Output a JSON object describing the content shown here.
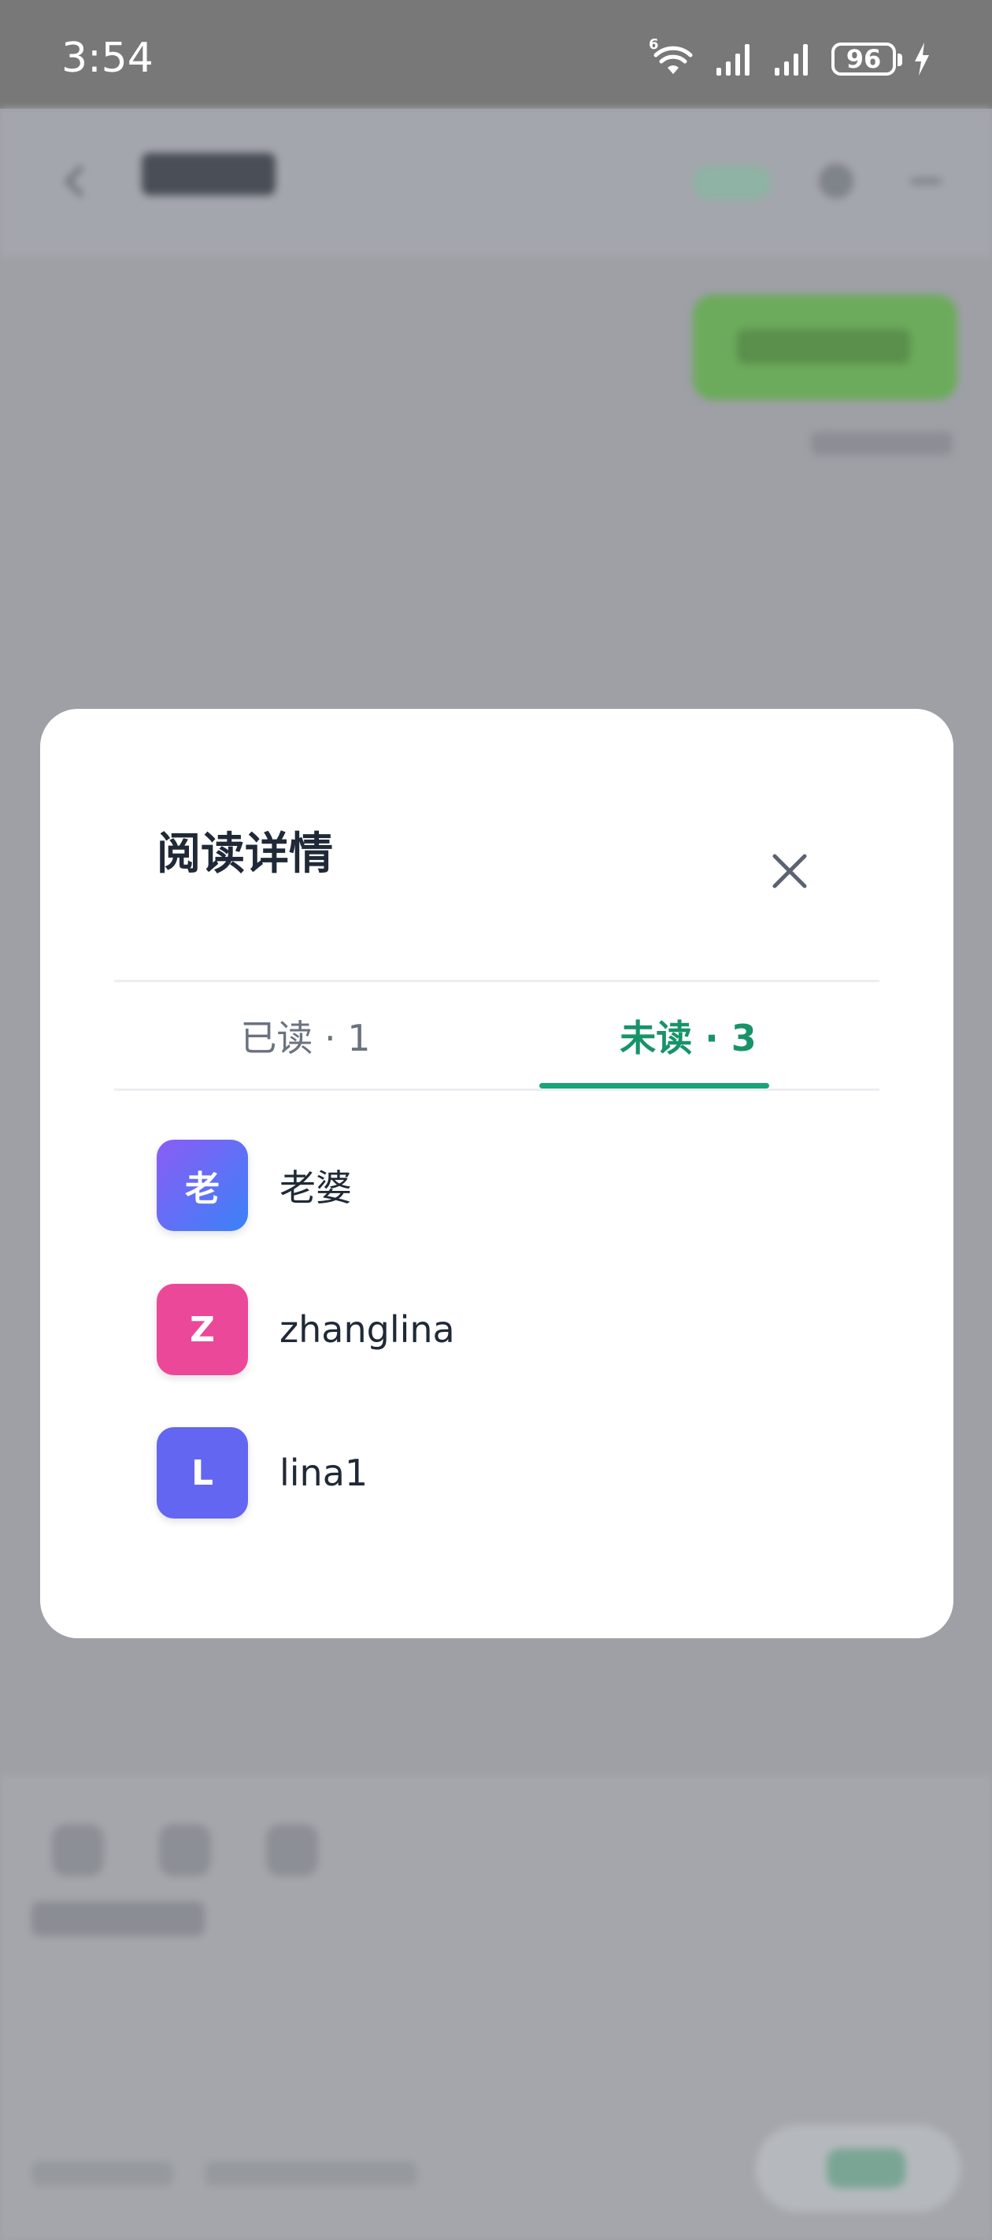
{
  "status_bar": {
    "time": "3:54",
    "network_label": "6",
    "battery": "96",
    "icons": [
      "wifi-icon",
      "signal-icon",
      "signal-icon",
      "battery-icon",
      "charging-icon"
    ]
  },
  "modal": {
    "title": "阅读详情",
    "close_icon": "close-icon",
    "tabs": [
      {
        "label": "已读 · 1",
        "active": false
      },
      {
        "label": "未读 · 3",
        "active": true
      }
    ],
    "members": [
      {
        "avatar_text": "老",
        "name": "老婆",
        "avatar_colors": [
          "#8b5cf6",
          "#3b82f6"
        ]
      },
      {
        "avatar_text": "Z",
        "name": "zhanglina",
        "avatar_colors": [
          "#ec4899",
          "#ec4899"
        ]
      },
      {
        "avatar_text": "L",
        "name": "lina1",
        "avatar_colors": [
          "#6366f1",
          "#6366f1"
        ]
      }
    ]
  },
  "colors": {
    "accent": "#17936a",
    "modal_bg": "#ffffff",
    "overlay": "#9ea0a6"
  }
}
